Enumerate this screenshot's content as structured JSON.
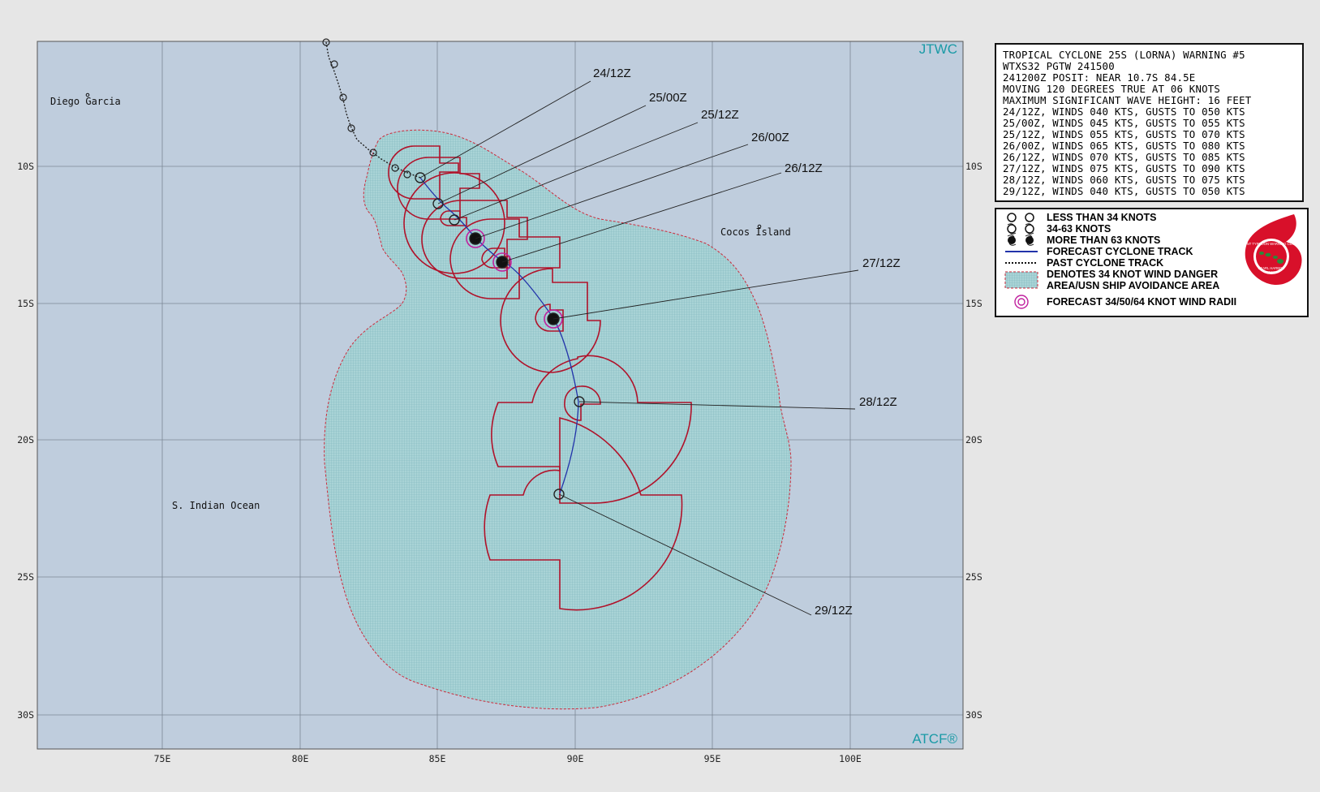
{
  "map": {
    "title_mark": "JTWC",
    "footer_mark": "ATCF®",
    "lon_labels": [
      "75E",
      "80E",
      "85E",
      "90E",
      "95E",
      "100E"
    ],
    "lat_labels": [
      "10S",
      "15S",
      "20S",
      "25S",
      "30S"
    ],
    "places": [
      {
        "name": "Diego Garcia"
      },
      {
        "name": "Cocos Island"
      },
      {
        "name": "S. Indian Ocean"
      }
    ],
    "forecast_labels": [
      "24/12Z",
      "25/00Z",
      "25/12Z",
      "26/00Z",
      "26/12Z",
      "27/12Z",
      "28/12Z",
      "29/12Z"
    ],
    "colors": {
      "ocean": "#bfcddd",
      "danger_area": "#9fd0d3",
      "wind_radii": "#b0122a",
      "track": "#2233aa",
      "grid": "#7b8796"
    }
  },
  "warning": {
    "lines": [
      "TROPICAL CYCLONE 25S (LORNA) WARNING #5",
      "WTXS32 PGTW 241500",
      "241200Z POSIT: NEAR 10.7S 84.5E",
      "MOVING 120 DEGREES TRUE AT 06 KNOTS",
      "MAXIMUM SIGNIFICANT WAVE HEIGHT: 16 FEET",
      "24/12Z, WINDS 040 KTS, GUSTS TO 050 KTS",
      "25/00Z, WINDS 045 KTS, GUSTS TO 055 KTS",
      "25/12Z, WINDS 055 KTS, GUSTS TO 070 KTS",
      "26/00Z, WINDS 065 KTS, GUSTS TO 080 KTS",
      "26/12Z, WINDS 070 KTS, GUSTS TO 085 KTS",
      "27/12Z, WINDS 075 KTS, GUSTS TO 090 KTS",
      "28/12Z, WINDS 060 KTS, GUSTS TO 075 KTS",
      "29/12Z, WINDS 040 KTS, GUSTS TO 050 KTS"
    ]
  },
  "legend": {
    "less_34": "LESS THAN 34 KNOTS",
    "k34_63": "34-63 KNOTS",
    "more_63": "MORE THAN 63 KNOTS",
    "forecast_track": "FORECAST CYCLONE TRACK",
    "past_track": "PAST CYCLONE TRACK",
    "danger_line1": "DENOTES 34 KNOT WIND DANGER",
    "danger_line2": "AREA/USN SHIP AVOIDANCE AREA",
    "wind_radii": "FORECAST 34/50/64 KNOT WIND RADII",
    "logo_text": [
      "JOINT TYPHOON WARNING CENTER",
      "PEARL HARBOR",
      "HAWAII"
    ]
  }
}
